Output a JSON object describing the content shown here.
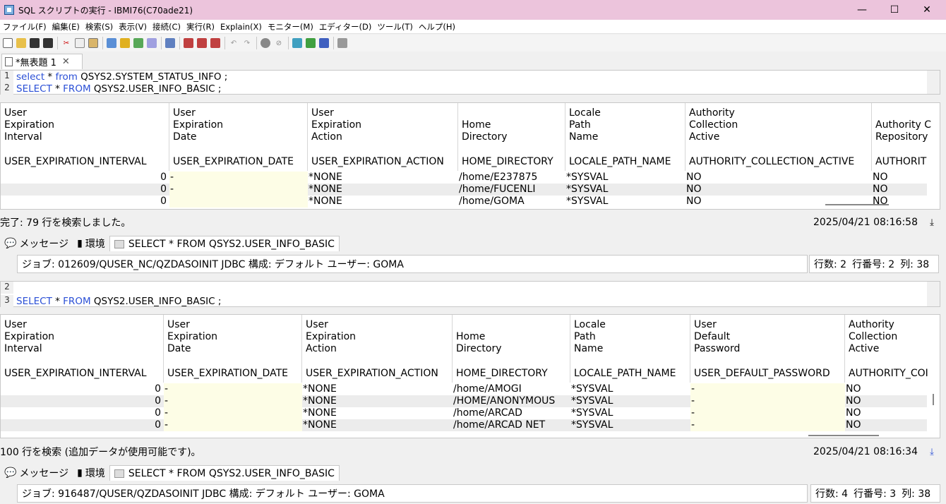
{
  "window": {
    "title": "SQL スクリプトの実行 - IBMI76(C70ade21)",
    "min": "—",
    "max": "☐",
    "close": "✕"
  },
  "menu": [
    "ファイル(F)",
    "編集(E)",
    "検索(S)",
    "表示(V)",
    "接続(C)",
    "実行(R)",
    "Explain(X)",
    "モニター(M)",
    "エディター(D)",
    "ツール(T)",
    "ヘルプ(H)"
  ],
  "doc_tab": {
    "label": "*無表題 1",
    "close": "✕"
  },
  "editor1": {
    "lines": [
      {
        "no": "1",
        "kw1": "select",
        "op": " * ",
        "kw2": "from",
        "rest": " QSYS2.SYSTEM_STATUS_INFO ;"
      },
      {
        "no": "2",
        "kw1": "SELECT",
        "op": " * ",
        "kw2": "FROM",
        "rest": " QSYS2.USER_INFO_BASIC ;"
      }
    ]
  },
  "grid1": {
    "columns": [
      {
        "label_lines": [
          "User",
          "Expiration",
          "Interval"
        ],
        "name": "USER_EXPIRATION_INTERVAL"
      },
      {
        "label_lines": [
          "User",
          "Expiration",
          "Date"
        ],
        "name": "USER_EXPIRATION_DATE"
      },
      {
        "label_lines": [
          "User",
          "Expiration",
          "Action"
        ],
        "name": "USER_EXPIRATION_ACTION"
      },
      {
        "label_lines": [
          "",
          "Home",
          "Directory"
        ],
        "name": "HOME_DIRECTORY"
      },
      {
        "label_lines": [
          "Locale",
          "Path",
          "Name"
        ],
        "name": "LOCALE_PATH_NAME"
      },
      {
        "label_lines": [
          "Authority",
          "Collection",
          "Active"
        ],
        "name": "AUTHORITY_COLLECTION_ACTIVE"
      },
      {
        "label_lines": [
          "",
          "Authority C",
          "Repository"
        ],
        "name": "AUTHORIT"
      }
    ],
    "rows": [
      [
        "0",
        "-",
        "*NONE",
        "/home/E237875",
        "*SYSVAL",
        "NO",
        "NO"
      ],
      [
        "0",
        "-",
        "*NONE",
        "/home/FUCENLI",
        "*SYSVAL",
        "NO",
        "NO"
      ],
      [
        "0",
        "",
        "*NONE",
        "/home/GOMA",
        "*SYSVAL",
        "NO",
        "NO"
      ]
    ]
  },
  "status1": {
    "text": "完了: 79 行を検索しました。",
    "timestamp": "2025/04/21 08:16:58"
  },
  "tabs_a": {
    "messages": "メッセージ",
    "env": "環境",
    "query": "SELECT * FROM QSYS2.USER_INFO_BASIC"
  },
  "job1": {
    "text": "ジョブ: 012609/QUSER_NC/QZDASOINIT    JDBC 構成: デフォルト    ユーザー: GOMA",
    "rows": "行数: 2",
    "rowno": "行番号: 2",
    "col": "列: 38"
  },
  "editor2": {
    "lines": [
      {
        "no": "2",
        "kw1": "",
        "op": "",
        "kw2": "",
        "rest": ""
      },
      {
        "no": "3",
        "kw1": "SELECT",
        "op": " * ",
        "kw2": "FROM",
        "rest": " QSYS2.USER_INFO_BASIC ;"
      }
    ]
  },
  "grid2": {
    "columns": [
      {
        "label_lines": [
          "User",
          "Expiration",
          "Interval"
        ],
        "name": "USER_EXPIRATION_INTERVAL"
      },
      {
        "label_lines": [
          "User",
          "Expiration",
          "Date"
        ],
        "name": "USER_EXPIRATION_DATE"
      },
      {
        "label_lines": [
          "User",
          "Expiration",
          "Action"
        ],
        "name": "USER_EXPIRATION_ACTION"
      },
      {
        "label_lines": [
          "",
          "Home",
          "Directory"
        ],
        "name": "HOME_DIRECTORY"
      },
      {
        "label_lines": [
          "Locale",
          "Path",
          "Name"
        ],
        "name": "LOCALE_PATH_NAME"
      },
      {
        "label_lines": [
          "User",
          "Default",
          "Password"
        ],
        "name": "USER_DEFAULT_PASSWORD"
      },
      {
        "label_lines": [
          "Authority",
          "Collection",
          "Active"
        ],
        "name": "AUTHORITY_COI"
      }
    ],
    "rows": [
      [
        "0",
        "-",
        "*NONE",
        "/home/AMOGI",
        "*SYSVAL",
        "-",
        "NO"
      ],
      [
        "0",
        "-",
        "*NONE",
        "/HOME/ANONYMOUS",
        "*SYSVAL",
        "-",
        "NO"
      ],
      [
        "0",
        "-",
        "*NONE",
        "/home/ARCAD",
        "*SYSVAL",
        "-",
        "NO"
      ],
      [
        "0",
        "-",
        "*NONE",
        "/home/ARCAD NET",
        "*SYSVAL",
        "-",
        "NO"
      ]
    ]
  },
  "status2": {
    "text": "100 行を検索 (追加データが使用可能です)。",
    "timestamp": "2025/04/21 08:16:34"
  },
  "job2": {
    "text": "ジョブ: 916487/QUSER/QZDASOINIT    JDBC 構成: デフォルト    ユーザー: GOMA",
    "rows": "行数: 4",
    "rowno": "行番号: 3",
    "col": "列: 38"
  },
  "colors": {
    "titlebar": "#ecc4dc",
    "keyword": "#2a4fd6",
    "null_cell": "#fdfde6"
  }
}
